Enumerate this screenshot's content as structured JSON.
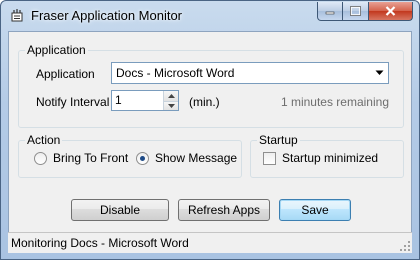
{
  "window": {
    "title": "Fraser Application Monitor",
    "icon": "app-icon"
  },
  "application_group": {
    "title": "Application",
    "app_label": "Application",
    "app_selected": "Docs - Microsoft Word",
    "interval_label": "Notify Interval",
    "interval_value": "1",
    "interval_unit": "(min.)",
    "remaining": "1 minutes remaining"
  },
  "action_group": {
    "title": "Action",
    "options": [
      {
        "label": "Bring To Front",
        "selected": false
      },
      {
        "label": "Show Message",
        "selected": true
      }
    ]
  },
  "startup_group": {
    "title": "Startup",
    "minimized_label": "Startup minimized",
    "minimized_checked": false
  },
  "buttons": {
    "disable": "Disable",
    "refresh": "Refresh Apps",
    "save": "Save"
  },
  "status": {
    "text": "Monitoring Docs - Microsoft Word"
  },
  "colors": {
    "titlebar": "#b4cbe6",
    "close_button": "#c2381e",
    "default_button": "#3c7fb1"
  }
}
